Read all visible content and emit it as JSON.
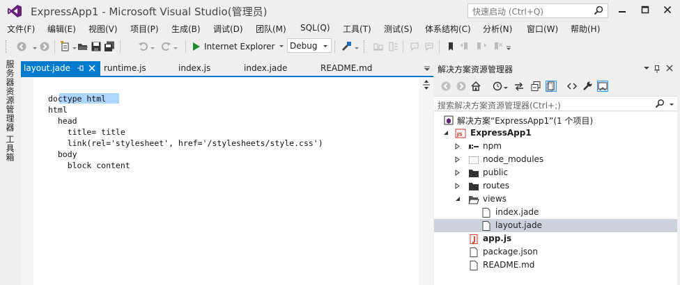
{
  "window": {
    "title": "ExpressApp1 - Microsoft Visual Studio(管理员)",
    "quick_launch_placeholder": "快速启动 (Ctrl+Q)"
  },
  "menu": [
    "文件(F)",
    "编辑(E)",
    "视图(V)",
    "项目(P)",
    "生成(B)",
    "调试(D)",
    "团队(M)",
    "SQL(Q)",
    "工具(T)",
    "测试(S)",
    "体系结构(C)",
    "分析(N)",
    "窗口(W)",
    "帮助(H)"
  ],
  "toolbar": {
    "run_target": "Internet Explorer",
    "configuration": "Debug"
  },
  "left_rail": {
    "server_explorer": "服务器资源管理器",
    "toolbox": "工具箱"
  },
  "editor": {
    "tabs": [
      {
        "label": "layout.jade",
        "active": true
      },
      {
        "label": "runtime.js"
      },
      {
        "label": "index.js"
      },
      {
        "label": "index.jade"
      },
      {
        "label": "README.md"
      }
    ],
    "code_lines": [
      "doctype html",
      "html",
      "  head",
      "    title= title",
      "    link(rel='stylesheet', href='/stylesheets/style.css')",
      "  body",
      "    block content"
    ]
  },
  "solution_explorer": {
    "title": "解决方案资源管理器",
    "search_placeholder": "搜索解决方案资源管理器(Ctrl+;)",
    "tree": [
      {
        "label": "解决方案“ExpressApp1”(1 个项目)",
        "level": 0,
        "icon": "solution-icon"
      },
      {
        "label": "ExpressApp1",
        "level": 1,
        "icon": "nodejs-project-icon",
        "expanded": true,
        "bold": true
      },
      {
        "label": "npm",
        "level": 2,
        "icon": "npm-icon",
        "expanded": false
      },
      {
        "label": "node_modules",
        "level": 2,
        "icon": "dotted-folder-icon",
        "expanded": false
      },
      {
        "label": "public",
        "level": 2,
        "icon": "folder-icon",
        "expanded": false
      },
      {
        "label": "routes",
        "level": 2,
        "icon": "folder-icon",
        "expanded": false
      },
      {
        "label": "views",
        "level": 2,
        "icon": "open-folder-icon",
        "expanded": true
      },
      {
        "label": "index.jade",
        "level": 3,
        "icon": "file-icon"
      },
      {
        "label": "layout.jade",
        "level": 3,
        "icon": "file-icon",
        "selected": true
      },
      {
        "label": "app.js",
        "level": 2,
        "icon": "startup-js-icon",
        "bold": true
      },
      {
        "label": "package.json",
        "level": 2,
        "icon": "file-icon"
      },
      {
        "label": "README.md",
        "level": 2,
        "icon": "file-icon"
      }
    ]
  },
  "colors": {
    "accent": "#007acc",
    "vs_purple": "#68217a",
    "selection": "#add6ff",
    "tree_selected": "#ccd1dc"
  }
}
